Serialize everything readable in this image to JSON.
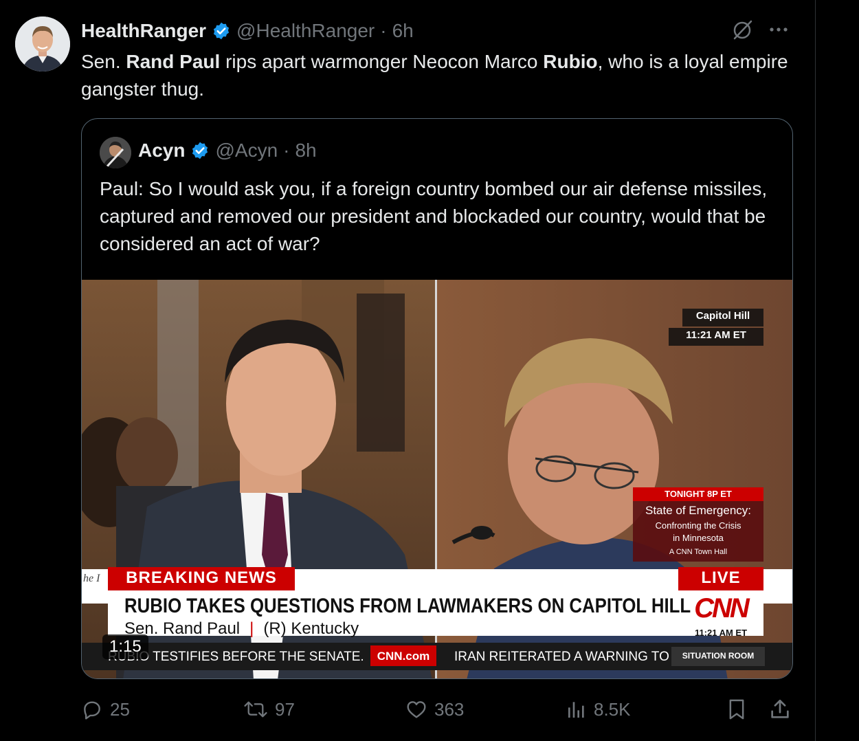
{
  "post": {
    "author": {
      "display_name": "HealthRanger",
      "handle": "@HealthRanger",
      "separator": "·",
      "time": "6h",
      "verified": true
    },
    "text_parts": [
      {
        "text": "Sen. ",
        "bold": false
      },
      {
        "text": "Rand Paul",
        "bold": true
      },
      {
        "text": " rips apart warmonger Neocon Marco ",
        "bold": false
      },
      {
        "text": "Rubio",
        "bold": true
      },
      {
        "text": ", who is a loyal empire gangster thug.",
        "bold": false
      }
    ],
    "actions": {
      "replies": "25",
      "reposts": "97",
      "likes": "363",
      "views": "8.5K"
    }
  },
  "quoted_post": {
    "author": {
      "display_name": "Acyn",
      "handle": "@Acyn",
      "separator": "·",
      "time": "8h",
      "verified": true
    },
    "text": "Paul: So I would ask you, if a foreign country bombed our air defense missiles, captured and removed our president and blockaded our country, would that be considered an act of war?",
    "video": {
      "duration": "1:15",
      "overlay": {
        "location": "Capitol Hill",
        "location_time": "11:21 AM ET",
        "promo_top": "TONIGHT 8P ET",
        "promo_title": "State of Emergency:",
        "promo_sub1": "Confronting the Crisis",
        "promo_sub2": "in Minnesota",
        "promo_brand": "A CNN Town Hall",
        "breaking": "BREAKING NEWS",
        "live": "LIVE",
        "headline": "RUBIO TAKES QUESTIONS FROM LAWMAKERS ON CAPITOL HILL",
        "subline_name": "Sen. Rand Paul",
        "subline_sep": "|",
        "subline_party": "(R) Kentucky",
        "network_logo": "CNN",
        "network_time": "11:21 AM ET",
        "ticker_left": "RUBIO TESTIFIES BEFORE THE SENATE.",
        "ticker_site": "CNN.com",
        "ticker_right": "IRAN REITERATED A WARNING TO",
        "ticker_show": "SITUATION ROOM",
        "bg_text": "he I"
      }
    }
  },
  "colors": {
    "background": "#000000",
    "text": "#e7e9ea",
    "muted": "#71767b",
    "verified": "#1d9bf0",
    "cnn_red": "#cc0000",
    "border": "#536471"
  },
  "icons": {
    "verified": "verified-badge-icon",
    "grok": "grok-icon",
    "more": "more-icon",
    "reply": "reply-icon",
    "repost": "repost-icon",
    "like": "like-icon",
    "views": "views-icon",
    "bookmark": "bookmark-icon",
    "share": "share-icon"
  }
}
